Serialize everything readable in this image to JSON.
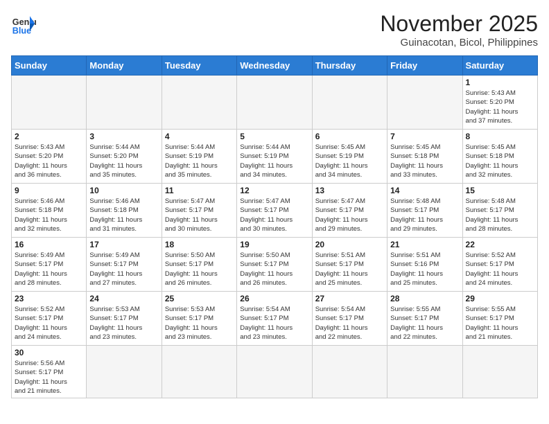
{
  "header": {
    "logo_general": "General",
    "logo_blue": "Blue",
    "month_title": "November 2025",
    "subtitle": "Guinacotan, Bicol, Philippines"
  },
  "days_of_week": [
    "Sunday",
    "Monday",
    "Tuesday",
    "Wednesday",
    "Thursday",
    "Friday",
    "Saturday"
  ],
  "weeks": [
    [
      {
        "day": "",
        "content": ""
      },
      {
        "day": "",
        "content": ""
      },
      {
        "day": "",
        "content": ""
      },
      {
        "day": "",
        "content": ""
      },
      {
        "day": "",
        "content": ""
      },
      {
        "day": "",
        "content": ""
      },
      {
        "day": "1",
        "content": "Sunrise: 5:43 AM\nSunset: 5:20 PM\nDaylight: 11 hours\nand 37 minutes."
      }
    ],
    [
      {
        "day": "2",
        "content": "Sunrise: 5:43 AM\nSunset: 5:20 PM\nDaylight: 11 hours\nand 36 minutes."
      },
      {
        "day": "3",
        "content": "Sunrise: 5:44 AM\nSunset: 5:20 PM\nDaylight: 11 hours\nand 35 minutes."
      },
      {
        "day": "4",
        "content": "Sunrise: 5:44 AM\nSunset: 5:19 PM\nDaylight: 11 hours\nand 35 minutes."
      },
      {
        "day": "5",
        "content": "Sunrise: 5:44 AM\nSunset: 5:19 PM\nDaylight: 11 hours\nand 34 minutes."
      },
      {
        "day": "6",
        "content": "Sunrise: 5:45 AM\nSunset: 5:19 PM\nDaylight: 11 hours\nand 34 minutes."
      },
      {
        "day": "7",
        "content": "Sunrise: 5:45 AM\nSunset: 5:18 PM\nDaylight: 11 hours\nand 33 minutes."
      },
      {
        "day": "8",
        "content": "Sunrise: 5:45 AM\nSunset: 5:18 PM\nDaylight: 11 hours\nand 32 minutes."
      }
    ],
    [
      {
        "day": "9",
        "content": "Sunrise: 5:46 AM\nSunset: 5:18 PM\nDaylight: 11 hours\nand 32 minutes."
      },
      {
        "day": "10",
        "content": "Sunrise: 5:46 AM\nSunset: 5:18 PM\nDaylight: 11 hours\nand 31 minutes."
      },
      {
        "day": "11",
        "content": "Sunrise: 5:47 AM\nSunset: 5:17 PM\nDaylight: 11 hours\nand 30 minutes."
      },
      {
        "day": "12",
        "content": "Sunrise: 5:47 AM\nSunset: 5:17 PM\nDaylight: 11 hours\nand 30 minutes."
      },
      {
        "day": "13",
        "content": "Sunrise: 5:47 AM\nSunset: 5:17 PM\nDaylight: 11 hours\nand 29 minutes."
      },
      {
        "day": "14",
        "content": "Sunrise: 5:48 AM\nSunset: 5:17 PM\nDaylight: 11 hours\nand 29 minutes."
      },
      {
        "day": "15",
        "content": "Sunrise: 5:48 AM\nSunset: 5:17 PM\nDaylight: 11 hours\nand 28 minutes."
      }
    ],
    [
      {
        "day": "16",
        "content": "Sunrise: 5:49 AM\nSunset: 5:17 PM\nDaylight: 11 hours\nand 28 minutes."
      },
      {
        "day": "17",
        "content": "Sunrise: 5:49 AM\nSunset: 5:17 PM\nDaylight: 11 hours\nand 27 minutes."
      },
      {
        "day": "18",
        "content": "Sunrise: 5:50 AM\nSunset: 5:17 PM\nDaylight: 11 hours\nand 26 minutes."
      },
      {
        "day": "19",
        "content": "Sunrise: 5:50 AM\nSunset: 5:17 PM\nDaylight: 11 hours\nand 26 minutes."
      },
      {
        "day": "20",
        "content": "Sunrise: 5:51 AM\nSunset: 5:17 PM\nDaylight: 11 hours\nand 25 minutes."
      },
      {
        "day": "21",
        "content": "Sunrise: 5:51 AM\nSunset: 5:16 PM\nDaylight: 11 hours\nand 25 minutes."
      },
      {
        "day": "22",
        "content": "Sunrise: 5:52 AM\nSunset: 5:17 PM\nDaylight: 11 hours\nand 24 minutes."
      }
    ],
    [
      {
        "day": "23",
        "content": "Sunrise: 5:52 AM\nSunset: 5:17 PM\nDaylight: 11 hours\nand 24 minutes."
      },
      {
        "day": "24",
        "content": "Sunrise: 5:53 AM\nSunset: 5:17 PM\nDaylight: 11 hours\nand 23 minutes."
      },
      {
        "day": "25",
        "content": "Sunrise: 5:53 AM\nSunset: 5:17 PM\nDaylight: 11 hours\nand 23 minutes."
      },
      {
        "day": "26",
        "content": "Sunrise: 5:54 AM\nSunset: 5:17 PM\nDaylight: 11 hours\nand 23 minutes."
      },
      {
        "day": "27",
        "content": "Sunrise: 5:54 AM\nSunset: 5:17 PM\nDaylight: 11 hours\nand 22 minutes."
      },
      {
        "day": "28",
        "content": "Sunrise: 5:55 AM\nSunset: 5:17 PM\nDaylight: 11 hours\nand 22 minutes."
      },
      {
        "day": "29",
        "content": "Sunrise: 5:55 AM\nSunset: 5:17 PM\nDaylight: 11 hours\nand 21 minutes."
      }
    ],
    [
      {
        "day": "30",
        "content": "Sunrise: 5:56 AM\nSunset: 5:17 PM\nDaylight: 11 hours\nand 21 minutes."
      },
      {
        "day": "",
        "content": ""
      },
      {
        "day": "",
        "content": ""
      },
      {
        "day": "",
        "content": ""
      },
      {
        "day": "",
        "content": ""
      },
      {
        "day": "",
        "content": ""
      },
      {
        "day": "",
        "content": ""
      }
    ]
  ]
}
